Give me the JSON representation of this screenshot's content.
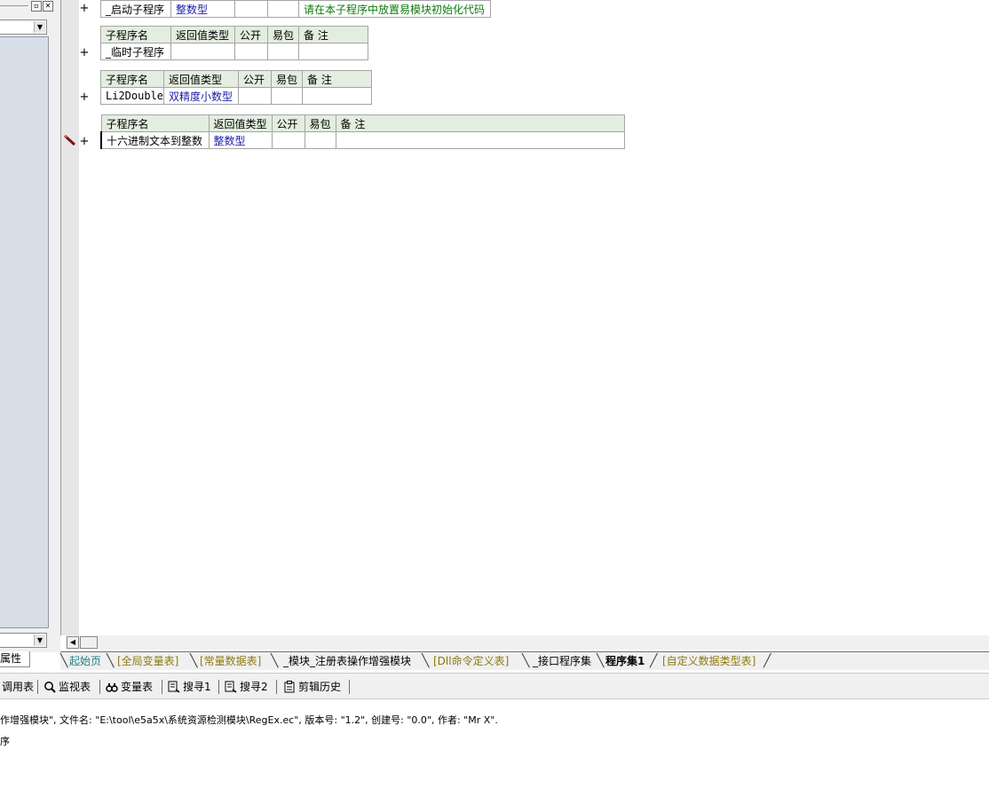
{
  "left_panel": {
    "tab_label": "属性",
    "pin_glyph": "▫",
    "close_glyph": "✕",
    "dropdown_glyph": "▼"
  },
  "editor": {
    "plus_glyph": "+",
    "table1": {
      "name": "_启动子程序",
      "return_type": "整数型",
      "note": "请在本子程序中放置易模块初始化代码"
    },
    "headers": {
      "name": "子程序名",
      "return_type": "返回值类型",
      "public": "公开",
      "easy_pack": "易包",
      "note": "备 注"
    },
    "table2": {
      "name": "_临时子程序",
      "return_type": ""
    },
    "table3": {
      "name": "Li2Double",
      "return_type": "双精度小数型"
    },
    "table4": {
      "name": "十六进制文本到整数",
      "return_type": "整数型"
    },
    "scroll_left_glyph": "◀"
  },
  "file_tabs": [
    {
      "label": "起始页",
      "style": "teal"
    },
    {
      "label": "[全局变量表]",
      "style": "gold"
    },
    {
      "label": "[常量数据表]",
      "style": "gold"
    },
    {
      "label": "_模块_注册表操作增强模块",
      "style": "dark"
    },
    {
      "label": "[Dll命令定义表]",
      "style": "gold"
    },
    {
      "label": "_接口程序集",
      "style": "dark"
    },
    {
      "label": "程序集1",
      "style": "active"
    },
    {
      "label": "[自定义数据类型表]",
      "style": "gold"
    }
  ],
  "toolbar": {
    "call_table": "调用表",
    "watch_table": "监视表",
    "var_table": "变量表",
    "search1": "搜寻1",
    "search2": "搜寻2",
    "clip_history": "剪辑历史"
  },
  "output": {
    "line1": "作增强模块\", 文件名: \"E:\\tool\\e5a5x\\系统资源检测模块\\RegEx.ec\", 版本号: \"1.2\", 创建号: \"0.0\", 作者: \"Mr X\".",
    "line2": "序"
  },
  "colors": {
    "header_bg": "#e3eee0",
    "type_blue": "#1b1ba8",
    "note_green": "#0c7a0c",
    "tab_gold": "#8a7a10",
    "tab_teal": "#1f7f88",
    "tree_bg": "#d7dee8"
  }
}
